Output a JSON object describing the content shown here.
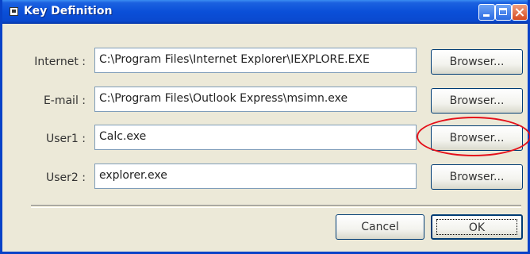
{
  "window": {
    "title": "Key Definition",
    "icon": "app-icon",
    "controls": [
      "minimize-icon",
      "maximize-icon",
      "close-icon"
    ]
  },
  "rows": [
    {
      "label": "Internet :",
      "value": "C:\\Program Files\\Internet Explorer\\IEXPLORE.EXE",
      "button": "Browser..."
    },
    {
      "label": "E-mail :",
      "value": "C:\\Program Files\\Outlook Express\\msimn.exe",
      "button": "Browser..."
    },
    {
      "label": "User1 :",
      "value": "Calc.exe",
      "button": "Browser..."
    },
    {
      "label": "User2 :",
      "value": "explorer.exe",
      "button": "Browser..."
    }
  ],
  "footer": {
    "cancel_label": "Cancel",
    "ok_label": "OK"
  },
  "colors": {
    "titlebar": "#0a4fd8",
    "dialog_bg": "#ece9d8",
    "highlight_ellipse": "#e4101a"
  }
}
